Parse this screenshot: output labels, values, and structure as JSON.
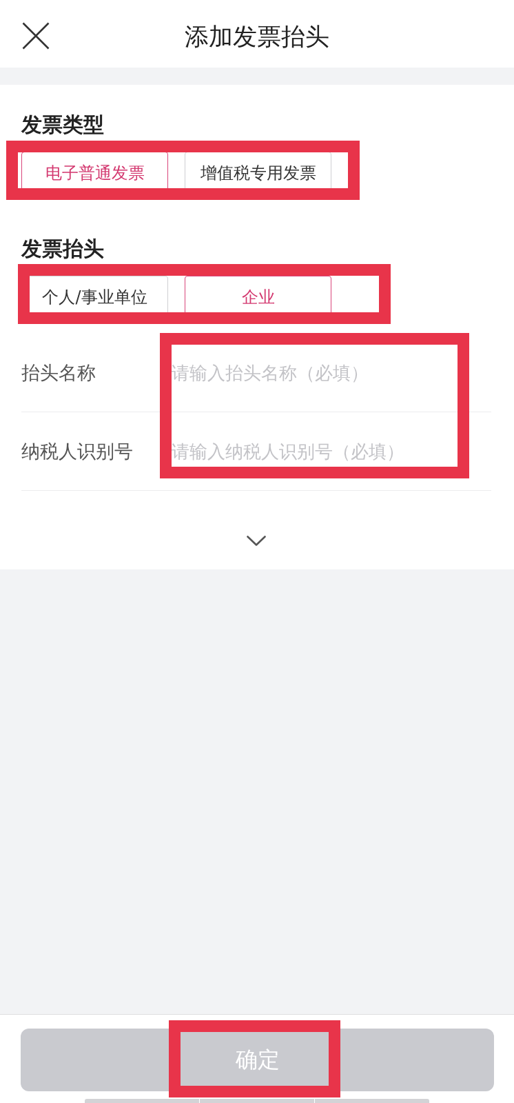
{
  "header": {
    "title": "添加发票抬头"
  },
  "invoice_type": {
    "title": "发票类型",
    "highlighted": true,
    "options": [
      {
        "label": "电子普通发票",
        "selected": true
      },
      {
        "label": "增值税专用发票",
        "selected": false
      }
    ]
  },
  "invoice_header": {
    "title": "发票抬头",
    "highlighted": true,
    "options": [
      {
        "label": "个人/事业单位",
        "selected": false
      },
      {
        "label": "企业",
        "selected": true
      }
    ]
  },
  "fields": {
    "highlighted": true,
    "items": [
      {
        "label": "抬头名称",
        "placeholder": "请输入抬头名称（必填）"
      },
      {
        "label": "纳税人识别号",
        "placeholder": "请输入纳税人识别号（必填）"
      }
    ]
  },
  "expand_toggle": {
    "expanded": false
  },
  "confirm_button": {
    "label": "确定",
    "disabled": true,
    "highlighted": true
  }
}
